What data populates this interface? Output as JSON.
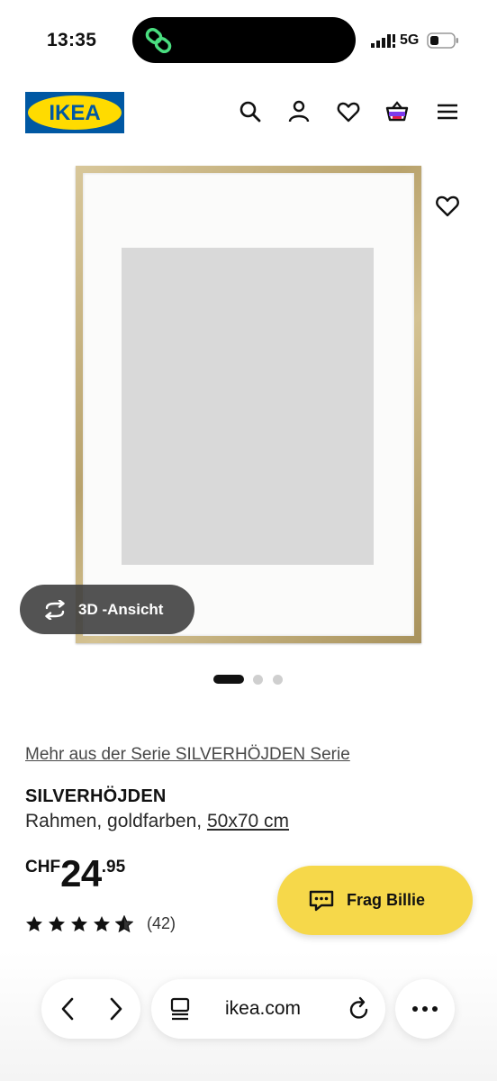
{
  "status_bar": {
    "time": "13:35",
    "network": "5G"
  },
  "header": {
    "logo_text": "IKEA",
    "icons": [
      "search-icon",
      "account-icon",
      "favorites-icon",
      "cart-icon",
      "menu-icon"
    ]
  },
  "gallery": {
    "view_3d_label": "3D -Ansicht",
    "page_count": 3,
    "active_page": 1
  },
  "product": {
    "series_link": "Mehr aus der Serie SILVERHÖJDEN Serie",
    "name": "SILVERHÖJDEN",
    "description_prefix": "Rahmen, goldfarben, ",
    "size": "50x70 cm",
    "price": {
      "currency": "CHF",
      "integer": "24",
      "decimal": ".95"
    },
    "rating": {
      "stars": 4.5,
      "max": 5,
      "count": "(42)"
    }
  },
  "assistant": {
    "label": "Frag Billie"
  },
  "browser": {
    "url": "ikea.com"
  },
  "colors": {
    "ikea_blue": "#0058a3",
    "ikea_yellow": "#ffdb00",
    "billie_yellow": "#f6d84a",
    "frame_gold": "#c2ad78"
  }
}
